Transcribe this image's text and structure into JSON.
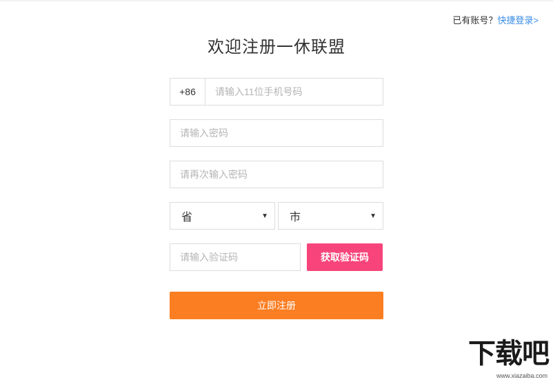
{
  "header": {
    "login_prompt": "已有账号？",
    "login_link": "快捷登录>"
  },
  "title": "欢迎注册一休联盟",
  "form": {
    "phone_prefix": "+86",
    "phone_placeholder": "请输入11位手机号码",
    "password_placeholder": "请输入密码",
    "password_confirm_placeholder": "请再次输入密码",
    "province_selected": "省",
    "city_selected": "市",
    "caret": "▼",
    "code_placeholder": "请输入验证码",
    "get_code_label": "获取验证码",
    "submit_label": "立即注册"
  },
  "watermark": {
    "logo": "下载吧",
    "url": "www.xiazaiba.com"
  },
  "colors": {
    "accent_link": "#3a8ee6",
    "code_button": "#f7447a",
    "submit_button": "#fb7e22"
  }
}
